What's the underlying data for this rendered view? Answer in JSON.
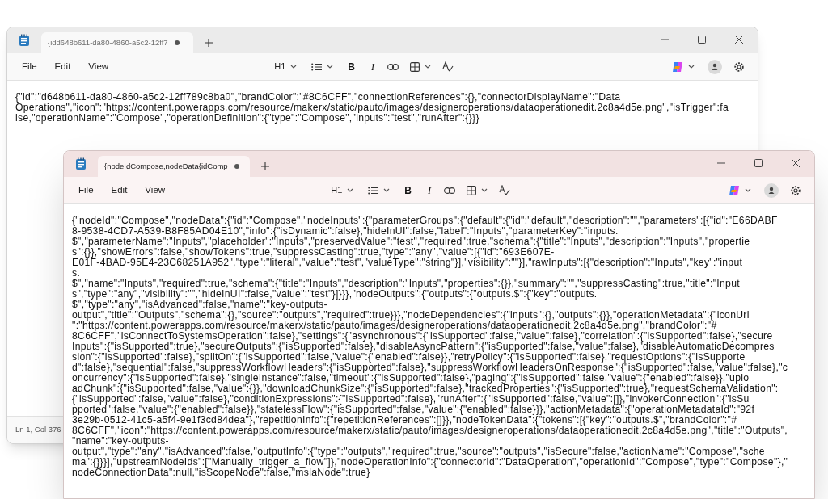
{
  "windows": [
    {
      "active": false,
      "tab_title": "{idd648b611-da80-4860-a5c2-12ff7",
      "modified": true,
      "menu": [
        "File",
        "Edit",
        "View"
      ],
      "heading_label": "H1",
      "bold_label": "B",
      "italic_label": "I",
      "status": "Ln 1, Col 376",
      "lines": [
        "{\"id\":\"d648b611-da80-4860-a5c2-12ff789c8ba0\",\"brandColor\":\"#8C6CFF\",\"connectionReferences\":{},\"connectorDisplayName\":\"Data",
        "Operations\",\"icon\":\"https://content.powerapps.com/resource/makerx/static/pauto/images/designeroperations/dataoperationedit.2c8a4d5e.png\",\"isTrigger\":fa",
        "lse,\"operationName\":\"Compose\",\"operationDefinition\":{\"type\":\"Compose\",\"inputs\":\"test\",\"runAfter\":{}}}"
      ]
    },
    {
      "active": true,
      "tab_title": "{nodeIdCompose,nodeData{idComp",
      "modified": true,
      "menu": [
        "File",
        "Edit",
        "View"
      ],
      "heading_label": "H1",
      "bold_label": "B",
      "italic_label": "I",
      "lines": [
        "{\"nodeId\":\"Compose\",\"nodeData\":{\"id\":\"Compose\",\"nodeInputs\":{\"parameterGroups\":{\"default\":{\"id\":\"default\",\"description\":\"\",\"parameters\":[{\"id\":\"E66DABF",
        "8-9538-4CD7-A539-B8F85AD04E10\",\"info\":{\"isDynamic\":false},\"hideInUI\":false,\"label\":\"Inputs\",\"parameterKey\":\"inputs.",
        "$\",\"parameterName\":\"Inputs\",\"placeholder\":\"Inputs\",\"preservedValue\":\"test\",\"required\":true,\"schema\":{\"title\":\"Inputs\",\"description\":\"Inputs\",\"propertie",
        "s\":{}},\"showErrors\":false,\"showTokens\":true,\"suppressCasting\":true,\"type\":\"any\",\"value\":[{\"id\":\"693E607E-",
        "E01F-4BAD-95E4-23C68251A952\",\"type\":\"literal\",\"value\":\"test\",\"valueType\":\"string\"}],\"visibility\":\"\"}],\"rawInputs\":[{\"description\":\"Inputs\",\"key\":\"input",
        "s.",
        "$\",\"name\":\"Inputs\",\"required\":true,\"schema\":{\"title\":\"Inputs\",\"description\":\"Inputs\",\"properties\":{}},\"summary\":\"\",\"suppressCasting\":true,\"title\":\"Input",
        "s\",\"type\":\"any\",\"visibility\":\"\",\"hideInUI\":false,\"value\":\"test\"}]}}},\"nodeOutputs\":{\"outputs\":{\"outputs.$\":{\"key\":\"outputs.",
        "$\",\"type\":\"any\",\"isAdvanced\":false,\"name\":\"key-outputs-",
        "output\",\"title\":\"Outputs\",\"schema\":{},\"source\":\"outputs\",\"required\":true}}},\"nodeDependencies\":{\"inputs\":{},\"outputs\":{}},\"operationMetadata\":{\"iconUri",
        "\":\"https://content.powerapps.com/resource/makerx/static/pauto/images/designeroperations/dataoperationedit.2c8a4d5e.png\",\"brandColor\":\"#",
        "8C6CFF\",\"isConnectToSystemsOperation\":false},\"settings\":{\"asynchronous\":{\"isSupported\":false,\"value\":false},\"correlation\":{\"isSupported\":false},\"secure",
        "Inputs\":{\"isSupported\":true},\"secureOutputs\":{\"isSupported\":false},\"disableAsyncPattern\":{\"isSupported\":false,\"value\":false},\"disableAutomaticDecompres",
        "sion\":{\"isSupported\":false},\"splitOn\":{\"isSupported\":false,\"value\":{\"enabled\":false}},\"retryPolicy\":{\"isSupported\":false},\"requestOptions\":{\"isSupporte",
        "d\":false},\"sequential\":false,\"suppressWorkflowHeaders\":{\"isSupported\":false},\"suppressWorkflowHeadersOnResponse\":{\"isSupported\":false,\"value\":false},\"c",
        "oncurrency\":{\"isSupported\":false},\"singleInstance\":false,\"timeout\":{\"isSupported\":false},\"paging\":{\"isSupported\":false,\"value\":{\"enabled\":false}},\"uplo",
        "adChunk\":{\"isSupported\":false,\"value\":{}},\"downloadChunkSize\":{\"isSupported\":false},\"trackedProperties\":{\"isSupported\":true},\"requestSchemaValidation\":",
        "{\"isSupported\":false,\"value\":false},\"conditionExpressions\":{\"isSupported\":false},\"runAfter\":{\"isSupported\":false,\"value\":[]},\"invokerConnection\":{\"isSu",
        "pported\":false,\"value\":{\"enabled\":false}},\"statelessFlow\":{\"isSupported\":false,\"value\":{\"enabled\":false}}},\"actionMetadata\":{\"operationMetadataId\":\"92f",
        "3e29b-0512-41c5-a5f4-9e1f3cd84dea\"},\"repetitionInfo\":{\"repetitionReferences\":[]}},\"nodeTokenData\":{\"tokens\":[{\"key\":\"outputs.$\",\"brandColor\":\"#",
        "8C6CFF\",\"icon\":\"https://content.powerapps.com/resource/makerx/static/pauto/images/designeroperations/dataoperationedit.2c8a4d5e.png\",\"title\":\"Outputs\",",
        "\"name\":\"key-outputs-",
        "output\",\"type\":\"any\",\"isAdvanced\":false,\"outputInfo\":{\"type\":\"outputs\",\"required\":true,\"source\":\"outputs\",\"isSecure\":false,\"actionName\":\"Compose\",\"sche",
        "ma\":{}}}],\"upstreamNodeIds\":[\"Manually_trigger_a_flow\"]},\"nodeOperationInfo\":{\"connectorId\":\"DataOperation\",\"operationId\":\"Compose\",\"type\":\"Compose\"},\"",
        "nodeConnectionData\":null,\"isScopeNode\":false,\"mslaNode\":true}"
      ]
    }
  ]
}
